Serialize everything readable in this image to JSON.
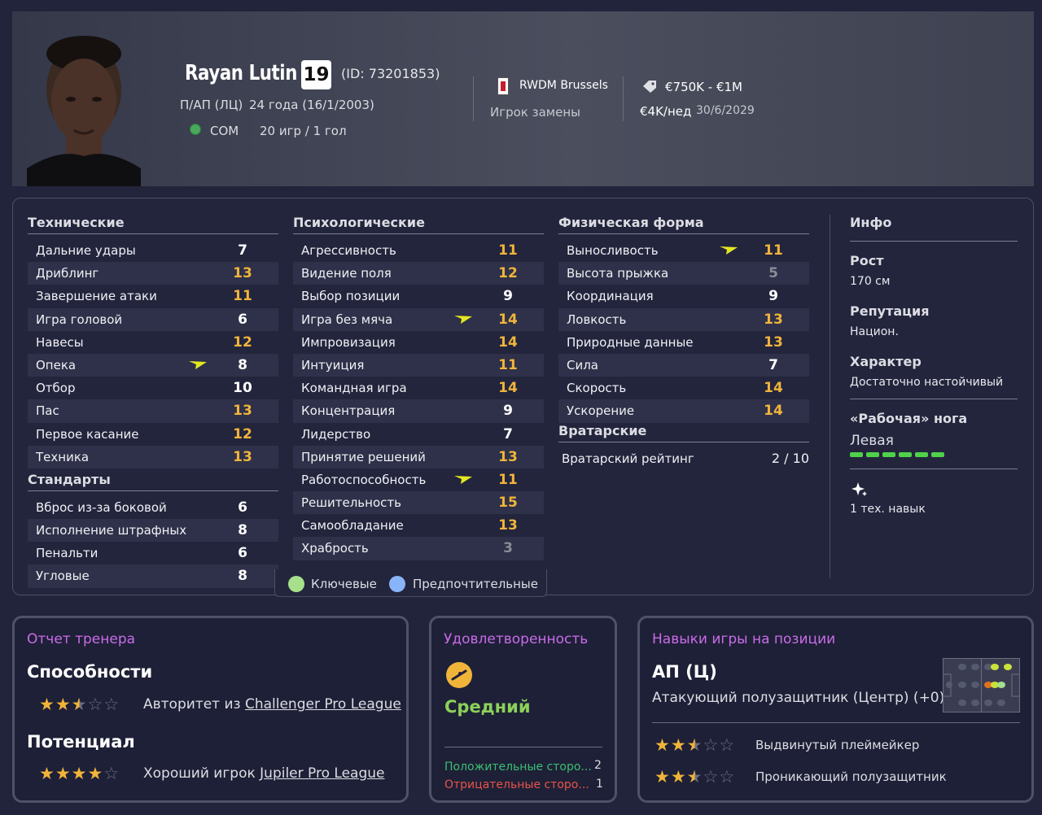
{
  "header": {
    "name": "Rayan Lutin",
    "number": "19",
    "id_text": "(ID: 73201853)",
    "positions": "П/АП (ЛЦ)",
    "age": "24 года (16/1/2003)",
    "nationality": "COM",
    "apps": "20 игр / 1 гол",
    "club": "RWDM Brussels",
    "role": "Игрок замены",
    "value": "€750K - €1M",
    "wage": "€4K/нед",
    "contract_expiry": "30/6/2029"
  },
  "technical": {
    "title": "Технические",
    "rows": [
      {
        "label": "Дальние удары",
        "value": "7"
      },
      {
        "label": "Дриблинг",
        "value": "13"
      },
      {
        "label": "Завершение атаки",
        "value": "11"
      },
      {
        "label": "Игра головой",
        "value": "6"
      },
      {
        "label": "Навесы",
        "value": "12"
      },
      {
        "label": "Опека",
        "value": "8"
      },
      {
        "label": "Отбор",
        "value": "10"
      },
      {
        "label": "Пас",
        "value": "13"
      },
      {
        "label": "Первое касание",
        "value": "12"
      },
      {
        "label": "Техника",
        "value": "13"
      }
    ]
  },
  "set_pieces": {
    "title": "Стандарты",
    "rows": [
      {
        "label": "Вброс из-за боковой",
        "value": "6"
      },
      {
        "label": "Исполнение штрафных",
        "value": "8"
      },
      {
        "label": "Пенальти",
        "value": "6"
      },
      {
        "label": "Угловые",
        "value": "8"
      }
    ]
  },
  "mental": {
    "title": "Психологические",
    "rows": [
      {
        "label": "Агрессивность",
        "value": "11"
      },
      {
        "label": "Видение поля",
        "value": "12"
      },
      {
        "label": "Выбор позиции",
        "value": "9"
      },
      {
        "label": "Игра без мяча",
        "value": "14"
      },
      {
        "label": "Импровизация",
        "value": "14"
      },
      {
        "label": "Интуиция",
        "value": "11"
      },
      {
        "label": "Командная игра",
        "value": "14"
      },
      {
        "label": "Концентрация",
        "value": "9"
      },
      {
        "label": "Лидерство",
        "value": "7"
      },
      {
        "label": "Принятие решений",
        "value": "13"
      },
      {
        "label": "Работоспособность",
        "value": "11"
      },
      {
        "label": "Решительность",
        "value": "15"
      },
      {
        "label": "Самообладание",
        "value": "13"
      },
      {
        "label": "Храбрость",
        "value": "3"
      }
    ]
  },
  "physical": {
    "title": "Физическая форма",
    "rows": [
      {
        "label": "Выносливость",
        "value": "11"
      },
      {
        "label": "Высота прыжка",
        "value": "5"
      },
      {
        "label": "Координация",
        "value": "9"
      },
      {
        "label": "Ловкость",
        "value": "13"
      },
      {
        "label": "Природные данные",
        "value": "13"
      },
      {
        "label": "Сила",
        "value": "7"
      },
      {
        "label": "Скорость",
        "value": "14"
      },
      {
        "label": "Ускорение",
        "value": "14"
      }
    ]
  },
  "goalkeeping": {
    "title": "Вратарские",
    "rating_label": "Вратарский рейтинг",
    "rating_value": "2 / 10"
  },
  "info": {
    "title": "Инфо",
    "height_label": "Рост",
    "height_value": "170 см",
    "reputation_label": "Репутация",
    "reputation_value": "Национ.",
    "personality_label": "Характер",
    "personality_value": "Достаточно настойчивый",
    "foot_label": "«Рабочая» нога",
    "foot_value": "Левая",
    "skills_text": "1 тех. навык"
  },
  "legend": {
    "key": "Ключевые",
    "preferred": "Предпочтительные"
  },
  "coach_report": {
    "title": "Отчет тренера",
    "ability_label": "Способности",
    "ability_stars": 2.5,
    "ability_prefix": "Авторитет из",
    "ability_league": "Challenger Pro League",
    "potential_label": "Потенциал",
    "potential_stars": 4,
    "potential_prefix": "Хороший игрок",
    "potential_league": "Jupiler Pro League"
  },
  "satisfaction": {
    "title": "Удовлетворенность",
    "level": "Средний",
    "positives_label": "Положительные сторо...",
    "positives_count": "2",
    "negatives_label": "Отрицательные сторо...",
    "negatives_count": "1"
  },
  "positional": {
    "title": "Навыки игры на позиции",
    "position_code": "АП (Ц)",
    "position_full": "Атакующий полузащитник (Центр) (+0)",
    "roles": [
      {
        "name": "Выдвинутый плеймейкер",
        "stars": 2.5
      },
      {
        "name": "Проникающий полузащитник",
        "stars": 2.5
      }
    ]
  },
  "colors": {
    "accent_yellow": "#f0b43a",
    "key_green": "#a6e08a",
    "preferred_blue": "#8ab4f8",
    "title_purple": "#c96ce8",
    "satisfaction_green": "#8cd15a",
    "positive_green": "#3bbf72",
    "negative_red": "#e8534a"
  }
}
